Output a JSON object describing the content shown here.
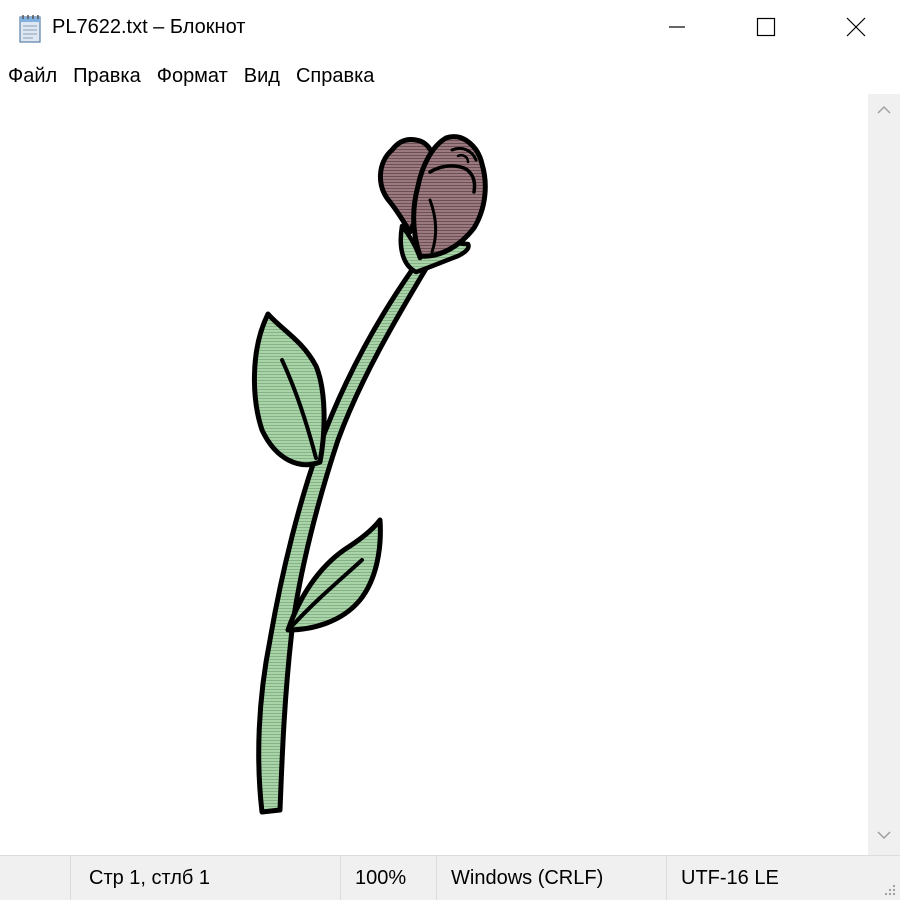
{
  "window": {
    "title": "PL7622.txt – Блокнот",
    "app_icon": "notepad-icon"
  },
  "controls": {
    "minimize_icon": "minimize-icon",
    "maximize_icon": "maximize-icon",
    "close_icon": "close-icon"
  },
  "menu": {
    "items": [
      "Файл",
      "Правка",
      "Формат",
      "Вид",
      "Справка"
    ]
  },
  "document": {
    "content_image": "rose-drawing",
    "colors": {
      "leaf_fill": "#a8d4a8",
      "bud_fill": "#8a6a6e",
      "outline": "#000000",
      "background": "#ffffff"
    }
  },
  "scrollbar": {
    "up_icon": "chevron-up-icon",
    "down_icon": "chevron-down-icon"
  },
  "status": {
    "position": "Стр 1, стлб 1",
    "zoom": "100%",
    "line_endings": "Windows (CRLF)",
    "encoding": "UTF-16 LE"
  }
}
